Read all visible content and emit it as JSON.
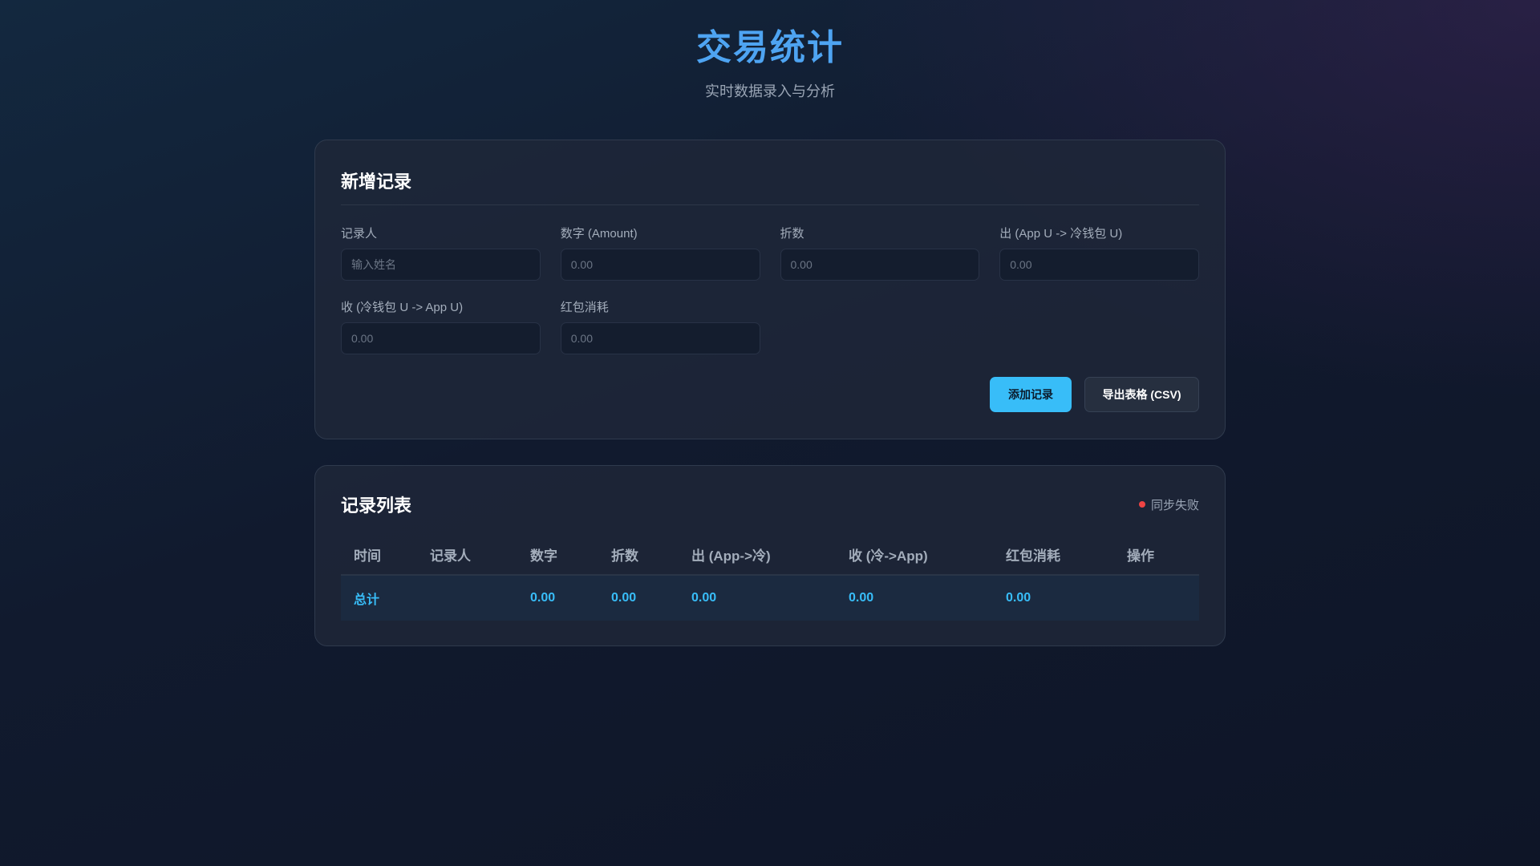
{
  "header": {
    "title": "交易统计",
    "subtitle": "实时数据录入与分析"
  },
  "form": {
    "title": "新增记录",
    "fields": [
      {
        "label": "记录人",
        "placeholder": "输入姓名"
      },
      {
        "label": "数字 (Amount)",
        "placeholder": "0.00"
      },
      {
        "label": "折数",
        "placeholder": "0.00"
      },
      {
        "label": "出 (App U -> 冷钱包 U)",
        "placeholder": "0.00"
      },
      {
        "label": "收 (冷钱包 U -> App U)",
        "placeholder": "0.00"
      },
      {
        "label": "红包消耗",
        "placeholder": "0.00"
      }
    ],
    "add_label": "添加记录",
    "export_label": "导出表格 (CSV)"
  },
  "list": {
    "title": "记录列表",
    "sync_status": "同步失败",
    "sync_color": "#ef4444",
    "columns": [
      "时间",
      "记录人",
      "数字",
      "折数",
      "出 (App->冷)",
      "收 (冷->App)",
      "红包消耗",
      "操作"
    ],
    "total": {
      "label": "总计",
      "amount": "0.00",
      "discount": "0.00",
      "out": "0.00",
      "in": "0.00",
      "redpacket": "0.00"
    }
  }
}
